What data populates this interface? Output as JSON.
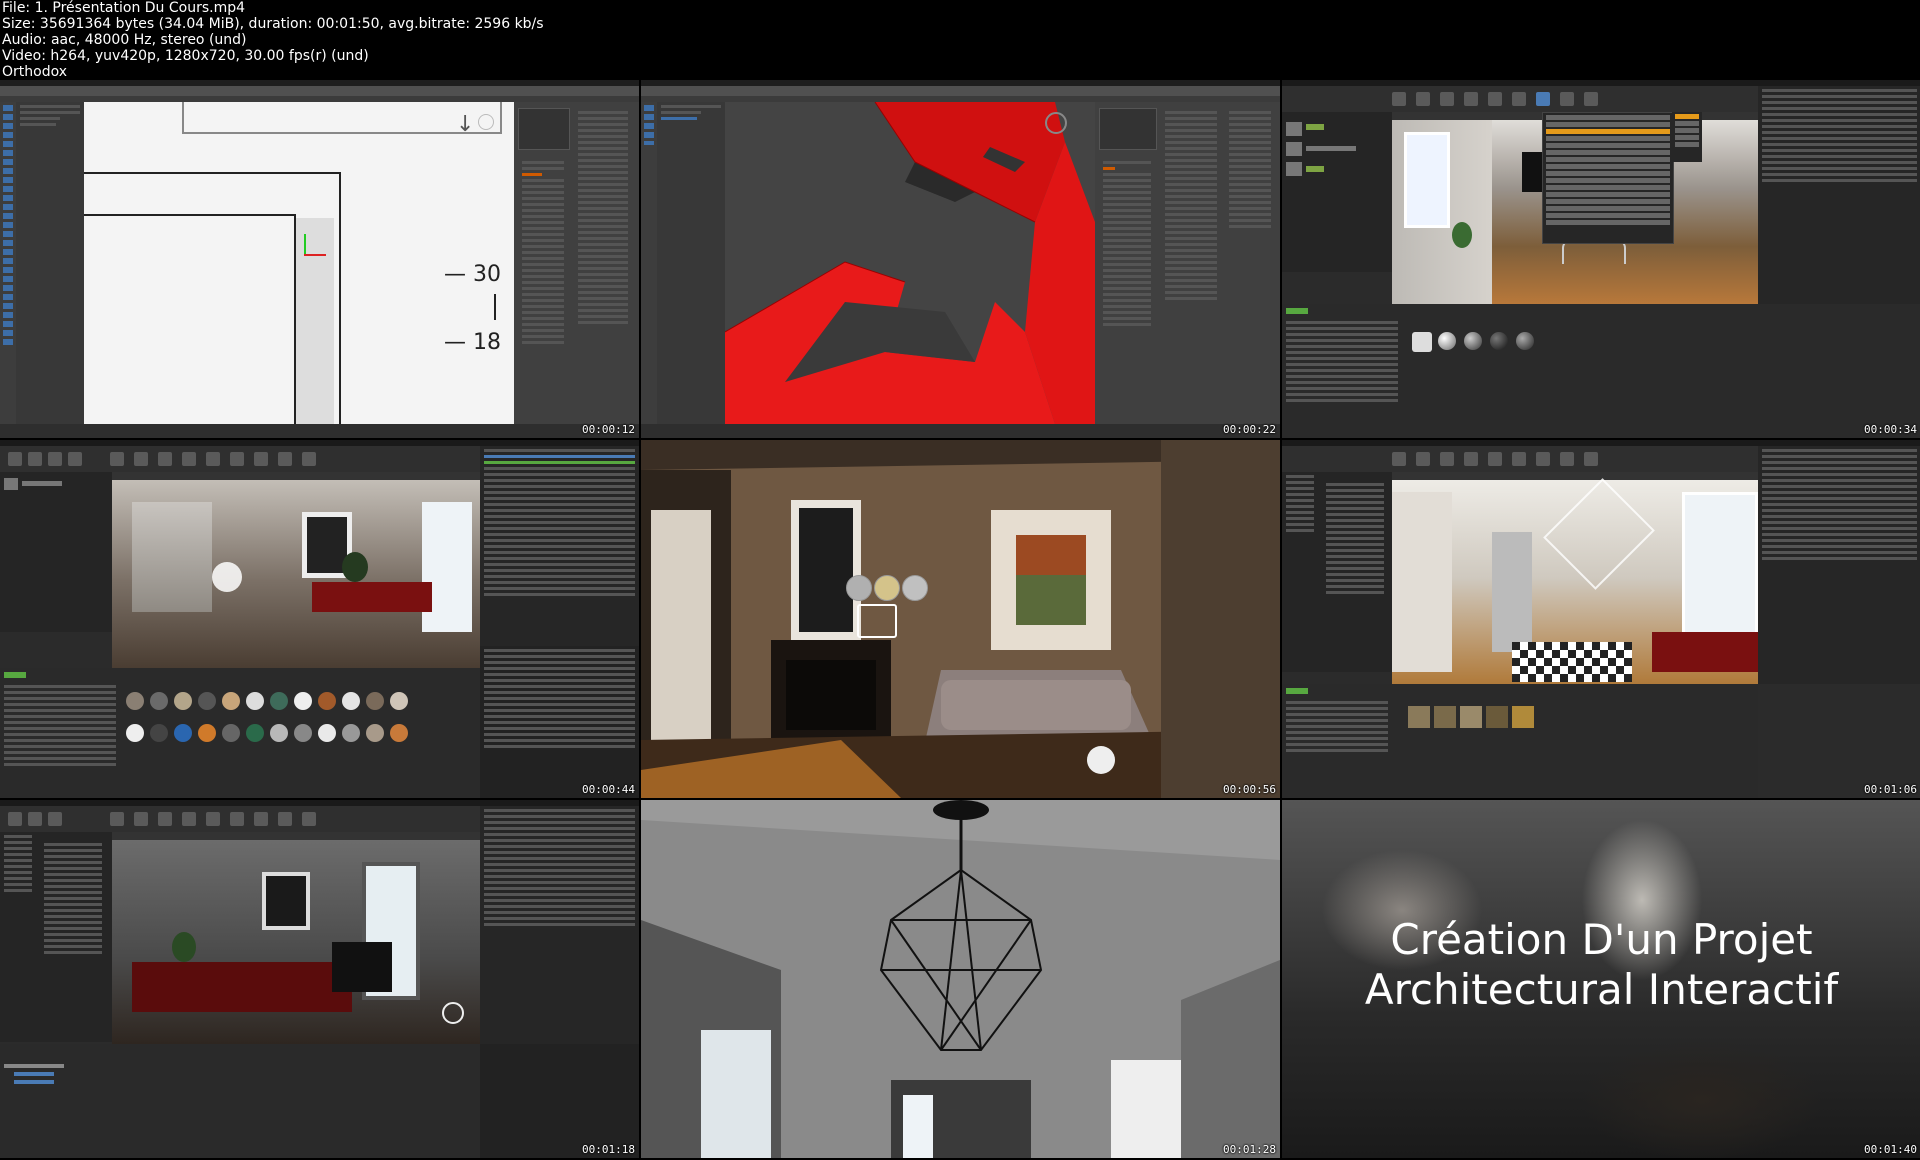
{
  "header": {
    "file": "File: 1. Présentation Du Cours.mp4",
    "size": "Size: 35691364 bytes (34.04 MiB), duration: 00:01:50, avg.bitrate: 2596 kb/s",
    "audio": "Audio: aac, 48000 Hz, stereo (und)",
    "video": "Video: h264, yuv420p, 1280x720, 30.00 fps(r) (und)",
    "author": "Orthodox"
  },
  "tiles": [
    {
      "timestamp": "00:00:12",
      "label_a": "30",
      "label_b": "18"
    },
    {
      "timestamp": "00:00:22"
    },
    {
      "timestamp": "00:00:34"
    },
    {
      "timestamp": "00:00:44"
    },
    {
      "timestamp": "00:00:56"
    },
    {
      "timestamp": "00:01:06"
    },
    {
      "timestamp": "00:01:18"
    },
    {
      "timestamp": "00:01:28"
    },
    {
      "timestamp": "00:01:40",
      "title_line1": "Création D'un Projet",
      "title_line2": "Architectural Interactif"
    }
  ],
  "colors": {
    "max_bg": "#444444",
    "ue_bg": "#2b2b2b",
    "red_mesh": "#e01010",
    "wall_tan": "#7a6048",
    "sofa": "#8c7f7c"
  }
}
